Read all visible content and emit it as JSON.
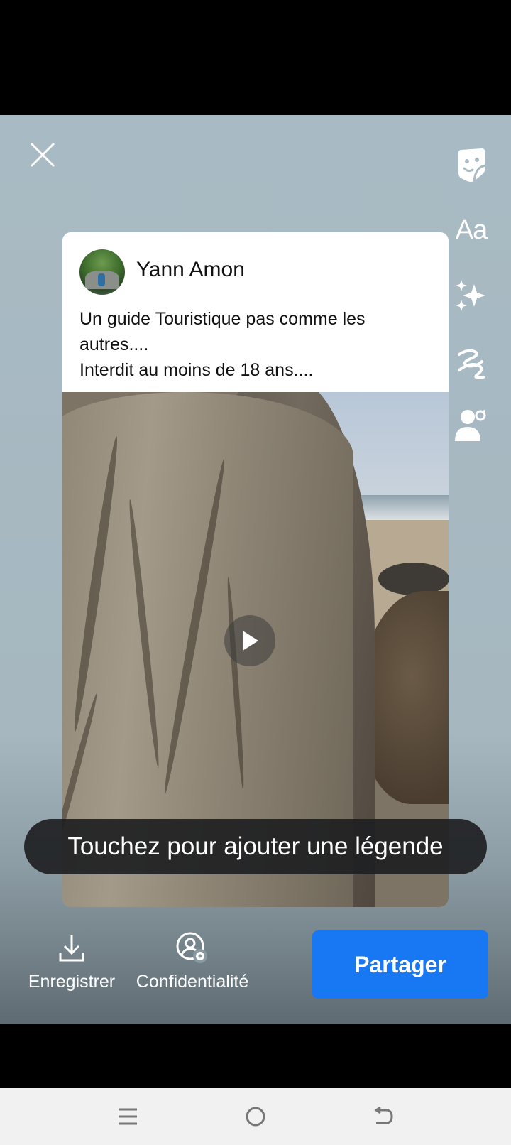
{
  "post": {
    "author": "Yann Amon",
    "caption_lines": [
      "Un guide Touristique pas comme les",
      "autres....",
      "Interdit au moins de 18 ans...."
    ]
  },
  "toolbar": {
    "text_tool_label": "Aa",
    "icons": [
      "sticker-icon",
      "text-icon",
      "effects-icon",
      "draw-icon",
      "tag-people-icon"
    ]
  },
  "caption_input": {
    "placeholder": "Touchez pour ajouter une légende"
  },
  "actions": {
    "save_label": "Enregistrer",
    "privacy_label": "Confidentialité",
    "share_label": "Partager"
  },
  "colors": {
    "share_button": "#1877f2",
    "editor_background": "#a8bac3"
  }
}
